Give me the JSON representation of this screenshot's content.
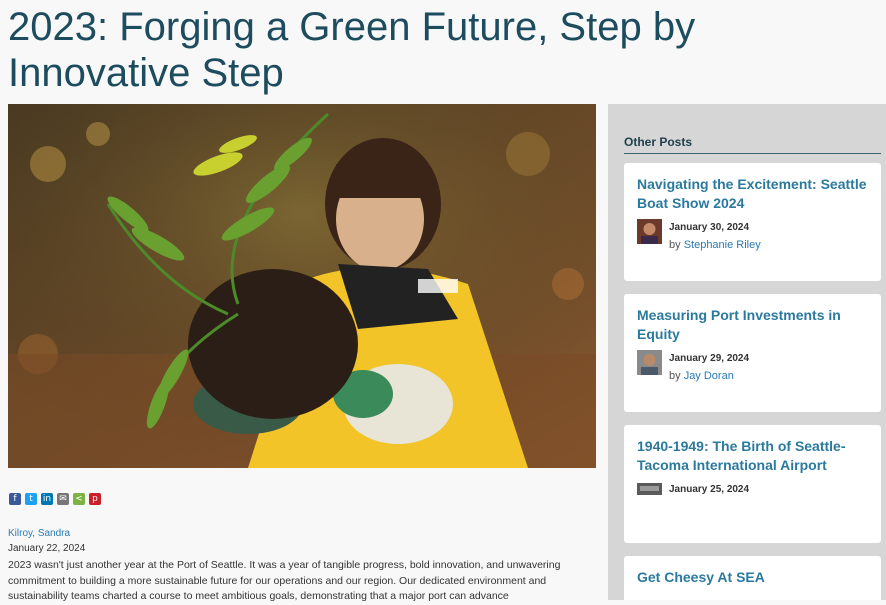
{
  "post": {
    "title": "2023: Forging a Green Future, Step by Innovative Step",
    "hero_image": "girl-holding-fern-plant-photo",
    "share_icons": [
      "facebook-icon",
      "twitter-icon",
      "linkedin-icon",
      "email-icon",
      "share-icon",
      "pinterest-icon"
    ],
    "author": "Kilroy, Sandra",
    "date": "January 22, 2024",
    "body": "2023 wasn't just another year at the Port of Seattle. It was a year of tangible progress, bold innovation, and unwavering commitment to building a more sustainable future for our operations and our region. Our dedicated environment and sustainability teams charted a course to meet ambitious goals, demonstrating that a major port can advance"
  },
  "sidebar": {
    "heading": "Other Posts",
    "posts": [
      {
        "title": "Navigating the Excitement: Seattle Boat Show 2024",
        "date": "January 30, 2024",
        "by_prefix": "by",
        "by_name": "Stephanie Riley"
      },
      {
        "title": "Measuring Port Investments in Equity",
        "date": "January 29, 2024",
        "by_prefix": "by",
        "by_name": "Jay Doran"
      },
      {
        "title": "1940-1949: The Birth of Seattle-Tacoma International Airport",
        "date": "January 25, 2024",
        "by_prefix": "",
        "by_name": ""
      },
      {
        "title": "Get Cheesy At SEA",
        "date": "",
        "by_prefix": "",
        "by_name": ""
      }
    ]
  },
  "colors": {
    "title": "#1d4c5e",
    "link": "#2a7ab3",
    "card_title": "#2b7a9e",
    "sidebar_bg": "#d6d6d6"
  }
}
